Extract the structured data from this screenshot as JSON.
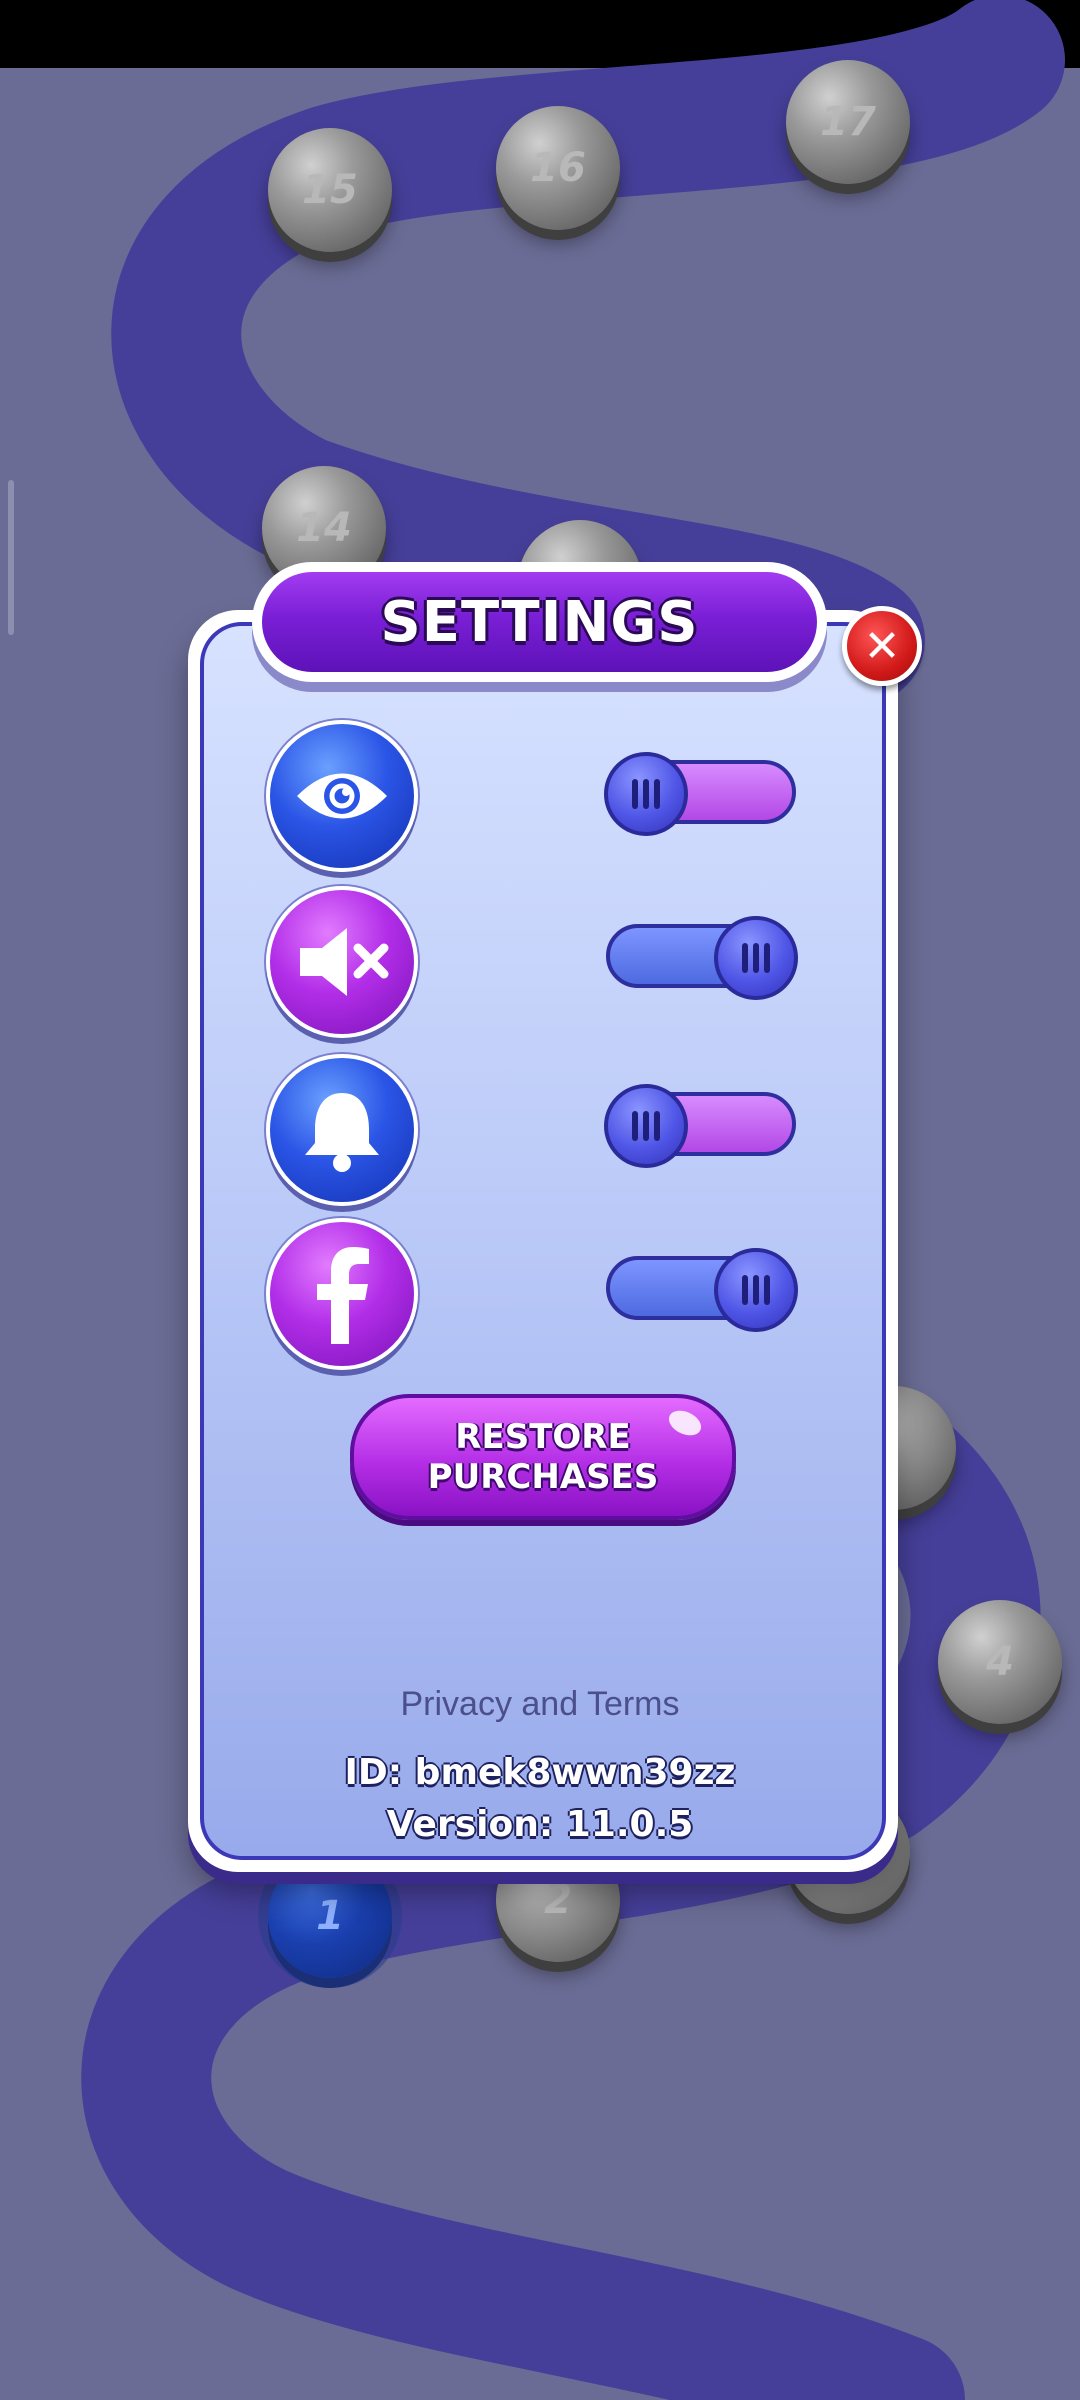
{
  "map": {
    "levels": [
      "15",
      "16",
      "17",
      "14",
      "4",
      "1",
      "2"
    ],
    "current_level": "1"
  },
  "dialog": {
    "title": "SETTINGS",
    "close_icon": "close-x-icon",
    "settings": [
      {
        "icon": "eye-icon",
        "state": "off"
      },
      {
        "icon": "speaker-muted-icon",
        "state": "on"
      },
      {
        "icon": "bell-icon",
        "state": "off"
      },
      {
        "icon": "facebook-icon",
        "state": "on"
      }
    ],
    "restore_line1": "RESTORE",
    "restore_line2": "PURCHASES",
    "privacy_text": "Privacy and  Terms",
    "id_text": "ID: bmek8wwn39zz",
    "version_text": "Version: 11.0.5"
  },
  "colors": {
    "background": "#6b6c95",
    "path": "#463f99",
    "accent_purple": "#7a1fd6",
    "accent_blue": "#2b55e6",
    "close_red": "#d11919"
  }
}
